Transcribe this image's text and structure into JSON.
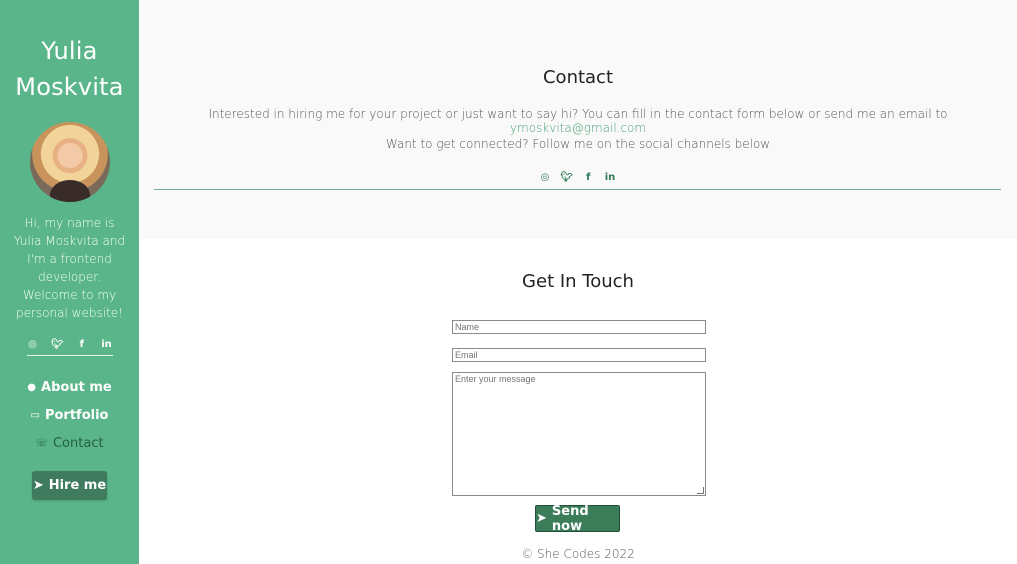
{
  "sidebar": {
    "name_line1": "Yulia",
    "name_line2": "Moskvita",
    "bio": "Hi, my name is Yulia Moskvita and I'm a frontend developer. Welcome to my personal website!",
    "nav": [
      {
        "label": "About me",
        "icon": "person-icon"
      },
      {
        "label": "Portfolio",
        "icon": "laptop-icon"
      },
      {
        "label": "Contact",
        "icon": "phone-icon"
      }
    ],
    "hire_label": "Hire me"
  },
  "contact": {
    "title": "Contact",
    "intro_prefix": "Interested in hiring me for your project or just want to say hi? You can fill in the contact form below or send me an email to ",
    "email": "ymoskvita@gmail.com",
    "follow": "Want to get connected? Follow me on the social channels below"
  },
  "social": {
    "instagram": "instagram-icon",
    "twitter": "twitter-icon",
    "facebook": "facebook-icon",
    "linkedin": "linkedin-icon"
  },
  "form": {
    "title": "Get In Touch",
    "name_placeholder": "Name",
    "email_placeholder": "Email",
    "message_placeholder": "Enter your message",
    "send_label": "Send now"
  },
  "footer": "© She Codes 2022",
  "colors": {
    "sidebar_bg": "#5ab58a",
    "button_bg": "#3e7b5f",
    "link": "#4ca475"
  }
}
